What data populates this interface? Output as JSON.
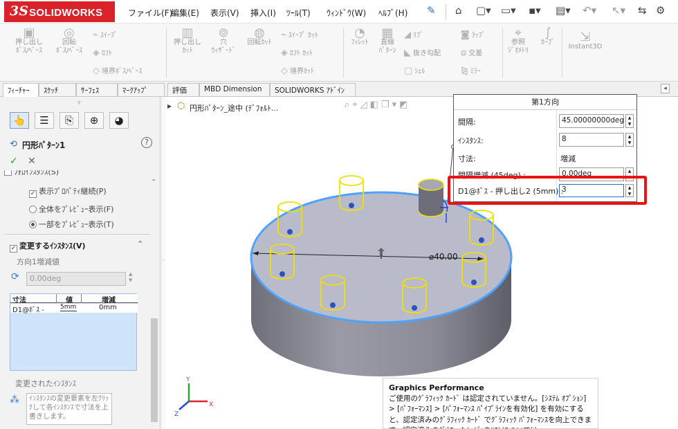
{
  "app": {
    "logo_ds": "3S",
    "logo_text": "SOLIDWORKS"
  },
  "menu": [
    "ファイル(F)",
    "編集(E)",
    "表示(V)",
    "挿入(I)",
    "ﾂｰﾙ(T)",
    "ｳｨﾝﾄﾞｳ(W)",
    "ﾍﾙﾌﾟ(H)"
  ],
  "ribbon": {
    "extrude_boss": "押し出し\nﾎﾞｽ/ﾍﾞｰｽ",
    "revolve_boss": "回転\nﾎﾞｽ/ﾍﾞｰｽ",
    "sweep": "ｽｲｰﾌﾟ",
    "loft": "ﾛﾌﾄ",
    "boundary_boss": "境界ﾎﾞｽ/ﾍﾞｰｽ",
    "extruded_cut": "押し出し\nｶｯﾄ",
    "hole_wizard": "穴\nｳｨｻﾞｰﾄﾞ",
    "revolved_cut": "回転ｶｯﾄ",
    "swept_cut": "ｽｲｰﾌﾟ ｶｯﾄ",
    "lofted_cut": "ﾛﾌﾄ ｶｯﾄ",
    "boundary_cut": "境界ｶｯﾄ",
    "fillet": "ﾌｨﾚｯﾄ",
    "linear_pattern": "直線\nﾊﾟﾀｰﾝ",
    "rib": "ﾘﾌﾞ",
    "draft": "抜き勾配",
    "shell": "ｼｪﾙ",
    "wrap": "ﾗｯﾌﾟ",
    "intersect": "交差",
    "mirror": "ﾐﾗｰ",
    "ref_geometry": "参照\nｼﾞｵﾒﾄﾘ",
    "curves": "ｶｰﾌﾞ",
    "instant3d": "Instant3D"
  },
  "tabs": [
    "ﾌｨｰﾁｬｰ",
    "ｽｹｯﾁ",
    "ｻｰﾌｪｽ",
    "ﾏｰｸｱｯﾌﾟ",
    "評価",
    "MBD Dimension",
    "SOLIDWORKS ｱﾄﾞｲﾝ"
  ],
  "pm": {
    "title": "円形ﾊﾟﾀｰﾝ1",
    "hidden_option": "ﾌｫﾛｲﾝｽﾀﾝｽ(S)",
    "opt_props": "表示ﾌﾟﾛﾊﾟﾃｨ継続(P)",
    "opt_full_preview": "全体をﾌﾟﾚﾋﾞｭｰ表示(F)",
    "opt_partial_preview": "一部をﾌﾟﾚﾋﾞｭｰ表示(T)",
    "section_title": "変更するｲﾝｽﾀﾝｽ(V)",
    "dir1_increment": "方向1増減値",
    "increment_value": "0.00deg",
    "table_headers": [
      "寸法",
      "値",
      "増減"
    ],
    "table_row": [
      "D1@ﾎﾞｽ -",
      "5mm",
      "0mm"
    ],
    "modified_label": "変更されたｲﾝｽﾀﾝｽ",
    "hint_text": "ｲﾝｽﾀﾝｽの変更要素を左ｸﾘｯｸして各ｲﾝｽﾀﾝｽで寸法を上書きします。"
  },
  "tree": {
    "item": "円形ﾊﾟﾀｰﾝ_途中 (ﾃﾞﾌｫﾙﾄ..."
  },
  "dialog": {
    "title": "第1方向",
    "rows": [
      {
        "label": "間隔:",
        "value": "45.00000000deg"
      },
      {
        "label": "ｲﾝｽﾀﾝｽ:",
        "value": "8"
      },
      {
        "label": "寸法:",
        "value": "増減"
      },
      {
        "label": "間隔増減 (45deg) :",
        "value": "0.00deg"
      }
    ],
    "edit_label": "D1@ﾎﾞｽ - 押し出し2 (5mm) :",
    "edit_value": "3"
  },
  "model": {
    "dimension_label": "⌀40.00"
  },
  "graphics_perf": {
    "title": "Graphics Performance",
    "body": "ご使用のｸﾞﾗﾌｨｯｸ ｶｰﾄﾞ は認定されていません。[ｼｽﾃﾑ ｵﾌﾟｼｮﾝ] > [ﾊﾟﾌｫｰﾏﾝｽ] > [ﾊﾟﾌｫｰﾏﾝｽ ﾊﾟｲﾌﾟﾗｲﾝを有効化] を有効にすると、認定済みのｸﾞﾗﾌｨｯｸ ｶｰﾄﾞ でｸﾞﾗﾌｨｯｸ ﾊﾟﾌｫｰﾏﾝｽを向上できます。認定済みのｸﾞﾗﾌｨｯｸ ｶｰﾄﾞ のﾘｽﾄについては"
  },
  "triad": {
    "x": "X",
    "y": "Y",
    "z": "Z"
  },
  "colors": {
    "brand": "#d9222a",
    "highlight_red": "#e11111",
    "preview_yellow": "#f0e000",
    "edge_blue": "#4da3ff"
  }
}
